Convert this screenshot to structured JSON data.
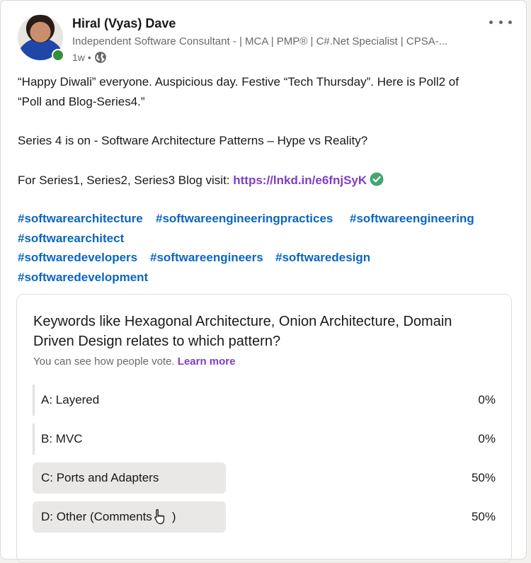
{
  "post": {
    "author_name": "Hiral (Vyas) Dave",
    "headline": "Independent Software Consultant - | MCA | PMP® | C#.Net Specialist | CPSA-...",
    "time": "1w",
    "separator": "•",
    "visibility_icon": "globe-icon",
    "menu_icon": "more-horizontal-icon",
    "text": {
      "line1": "“Happy Diwali” everyone. Auspicious day. Festive “Tech Thursday”. Here is Poll2 of",
      "line2": "“Poll and Blog-Series4.”",
      "line3": "Series 4 is on - Software Architecture Patterns – Hype vs Reality?",
      "line4_prefix": "For Series1, Series2, Series3 Blog visit: ",
      "link": "https://lnkd.in/e6fnjSyK"
    },
    "hashtags": [
      "#softwarearchitecture",
      "#softwareengineeringpractices",
      "#softwareengineering",
      "#softwarearchitect",
      "#softwaredevelopers",
      "#softwareengineers",
      "#softwaredesign",
      "#softwaredevelopment"
    ]
  },
  "poll": {
    "question": "Keywords like Hexagonal Architecture, Onion Architecture, Domain Driven Design relates to which pattern?",
    "note": "You can see how people vote.",
    "learn_more": "Learn more",
    "options": [
      {
        "label": "A: Layered",
        "percent_text": "0%",
        "percent": 0
      },
      {
        "label": "B: MVC",
        "percent_text": "0%",
        "percent": 0
      },
      {
        "label": "C: Ports and Adapters",
        "percent_text": "50%",
        "percent": 50
      },
      {
        "label": "D: Other (Comments",
        "suffix": ")",
        "percent_text": "50%",
        "percent": 50
      }
    ]
  },
  "colors": {
    "link_purple": "#7e3fc6",
    "hashtag_blue": "#0a66c2",
    "presence_green": "#378e3b",
    "verified_green": "#44a570"
  }
}
